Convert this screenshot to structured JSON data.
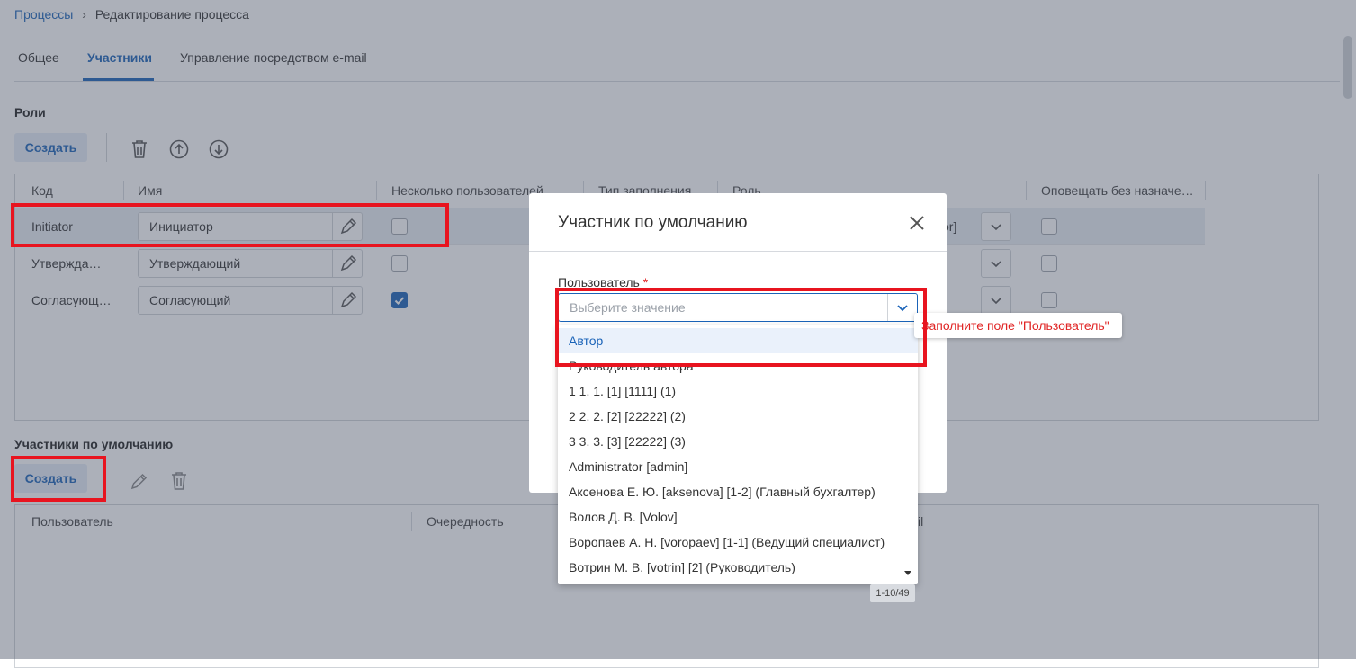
{
  "breadcrumb": {
    "root": "Процессы",
    "current": "Редактирование процесса"
  },
  "tabs": [
    "Общее",
    "Участники",
    "Управление посредством e-mail"
  ],
  "roles": {
    "title": "Роли",
    "create_label": "Создать",
    "columns": [
      "Код",
      "Имя",
      "Несколько пользователей",
      "Тип заполнения",
      "Роль",
      "Оповещать без назначе…"
    ],
    "rows": [
      {
        "code": "Initiator",
        "name": "Инициатор",
        "multi": false,
        "role_tail": "or]"
      },
      {
        "code": "Утвержда…",
        "name": "Утверждающий",
        "multi": false,
        "role_tail": ""
      },
      {
        "code": "Согласующ…",
        "name": "Согласующий",
        "multi": true,
        "role_tail": ""
      }
    ]
  },
  "defaults": {
    "title": "Участники по умолчанию",
    "create_label": "Создать",
    "columns": [
      "Пользователь",
      "Очередность",
      "il"
    ]
  },
  "modal": {
    "title": "Участник по умолчанию",
    "field_label": "Пользователь",
    "required_mark": "*",
    "placeholder": "Выберите значение",
    "tooltip": "Заполните поле \"Пользователь\"",
    "options": [
      "Автор",
      "Руководитель автора",
      "1 1. 1. [1] [1111] (1)",
      "2 2. 2. [2] [22222] (2)",
      "3 3. 3. [3] [22222] (3)",
      "Administrator [admin]",
      "Аксенова Е. Ю. [aksenova] [1-2] (Главный бухгалтер)",
      "Волов Д. В. [Volov]",
      "Воропаев А. Н. [voropaev] [1-1] (Ведущий специалист)",
      "Вотрин М. В. [votrin] [2] (Руководитель)"
    ],
    "pager": "1-10/49"
  },
  "colors": {
    "accent": "#1a63b8",
    "highlight": "#e8141f",
    "error": "#e02424"
  }
}
